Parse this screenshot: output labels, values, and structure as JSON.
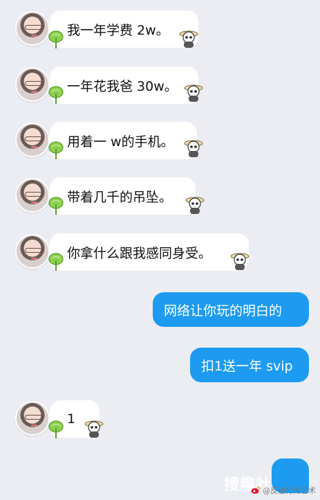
{
  "incoming": [
    {
      "text": "我一年学费 2w。"
    },
    {
      "text": "一年花我爸 30w。"
    },
    {
      "text": "用着一 w的手机。"
    },
    {
      "text": "带着几千的吊坠。"
    },
    {
      "text": "你拿什么跟我感同身受。"
    }
  ],
  "outgoing": [
    {
      "text": "网络让你玩的明白的"
    },
    {
      "text": "扣1送一年 svip"
    }
  ],
  "reply": {
    "text": "1"
  },
  "watermark": {
    "text": "@反逆行为艺术",
    "logo": "搜趣社"
  }
}
